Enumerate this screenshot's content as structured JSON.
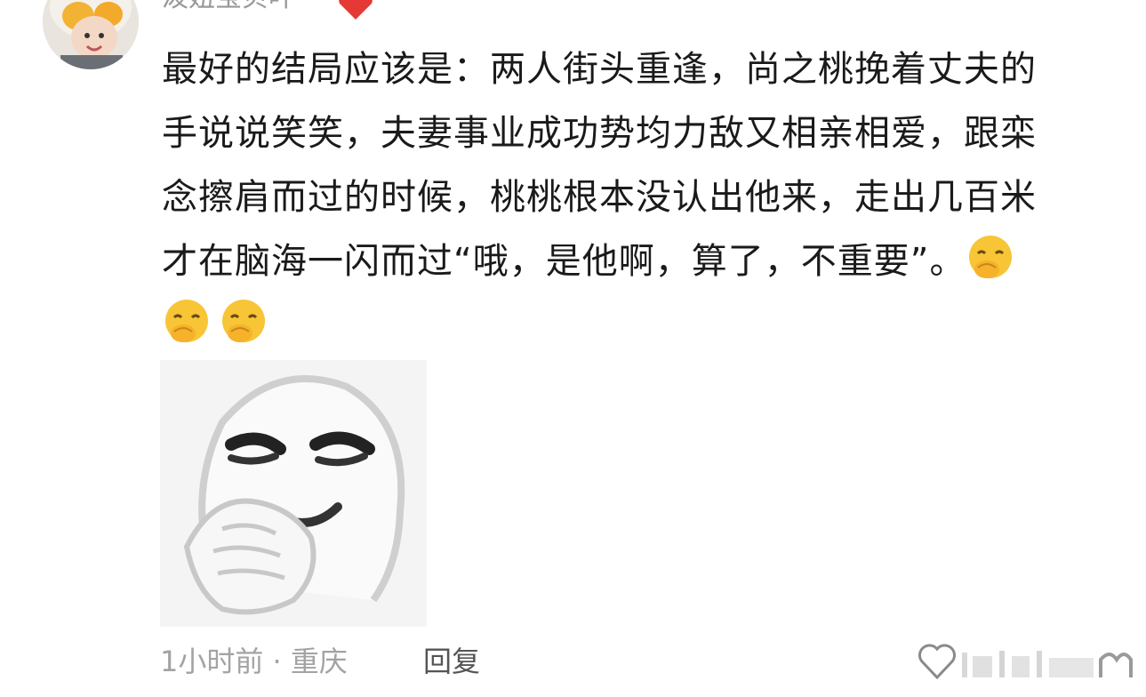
{
  "comment": {
    "username": "泼妞宝贝叶",
    "body_lines": [
      "最好的结局应该是：两人街头重逢，尚之桃挽着丈夫的",
      "手说说笑笑，夫妻事业成功势均力敌又相亲相爱，跟栾",
      "念擦肩而过的时候，桃桃根本没认出他来，走出几百米",
      "才在脑海一闪而过“哦，是他啊，算了，不重要”。"
    ],
    "emojis": [
      "hand-over-mouth-emoji",
      "hand-over-mouth-emoji",
      "hand-over-mouth-emoji"
    ],
    "sticker": "meme-face-covering-mouth-sticker",
    "meta": "1小时前 · 重庆",
    "reply_label": "回复"
  },
  "colors": {
    "text": "#1a1a1a",
    "meta": "#a3a3a3",
    "heart": "#e53935",
    "emoji_yellow": "#f7c535"
  }
}
